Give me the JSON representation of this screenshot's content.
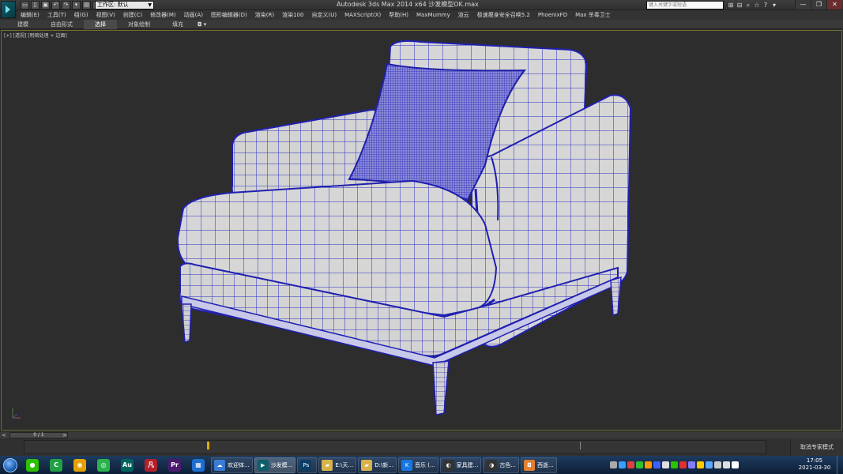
{
  "window": {
    "title": "Autodesk 3ds Max  2014 x64     沙发模型OK.max",
    "workspace_label": "工作区: 默认",
    "search_placeholder": "键入关键字或短语",
    "controls": [
      "—",
      "❐",
      "✕"
    ]
  },
  "quick_access": [
    "▭",
    "▯",
    "▣",
    "↶",
    "↷",
    "▾",
    "▤",
    "▾"
  ],
  "toolbar_right_icons": [
    "⊞",
    "⊟",
    "⌕",
    "☆",
    "?",
    "▾"
  ],
  "menu": [
    "编辑(E)",
    "工具(T)",
    "组(G)",
    "视图(V)",
    "创建(C)",
    "修改器(M)",
    "动画(A)",
    "图形编辑器(D)",
    "渲染(R)",
    "渲染100",
    "自定义(U)",
    "MAXScript(X)",
    "帮助(H)",
    "MaxMummy",
    "渲云",
    "极速瘦身安全召唤5.2",
    "PhoenixFD",
    "Max 杀毒卫士"
  ],
  "ribbon": {
    "tabs": [
      "建模",
      "自由形式",
      "选择",
      "对象绘制",
      "填充"
    ],
    "active_index": 2,
    "extra": "◘ ▾"
  },
  "viewport": {
    "label": "[+] [透视] [明暗处理 + 边面]",
    "border_color": "#6f6f2f",
    "wire_color": "#2020c0",
    "surface_color": "#d8d8d8"
  },
  "time_slider": {
    "counter": "0 / 1",
    "left_arrow": "<",
    "right_arrow": ">",
    "position": 0
  },
  "status": {
    "expert_mode": "取消专家模式"
  },
  "taskbar": {
    "pinned": [
      {
        "name": "wechat",
        "glyph": "●",
        "color": "#2dc100"
      },
      {
        "name": "camtasia",
        "glyph": "C",
        "color": "#23a045"
      },
      {
        "name": "chrome",
        "glyph": "◉",
        "color": "#e6a100"
      },
      {
        "name": "green-app",
        "glyph": "◎",
        "color": "#2bb24c"
      },
      {
        "name": "audition",
        "glyph": "Au",
        "color": "#00645e"
      },
      {
        "name": "red-app",
        "glyph": "凡",
        "color": "#b3202a"
      },
      {
        "name": "premiere",
        "glyph": "Pr",
        "color": "#4a1a6e"
      },
      {
        "name": "grid-app",
        "glyph": "▦",
        "color": "#1f6fd0"
      }
    ],
    "windows": [
      {
        "label": "欢迎体...",
        "glyph": "☁",
        "color": "#3a7bd5",
        "active": false
      },
      {
        "label": "沙发模...",
        "glyph": "▶",
        "color": "#0e5d6a",
        "active": true
      },
      {
        "label": "",
        "glyph": "Ps",
        "color": "#0a3d66",
        "active": false
      },
      {
        "label": "E:\\天...",
        "glyph": "▰",
        "color": "#d8b24a",
        "active": false
      },
      {
        "label": "D:\\新...",
        "glyph": "▰",
        "color": "#d8b24a",
        "active": false
      },
      {
        "label": "音乐 (...",
        "glyph": "K",
        "color": "#1678e0",
        "active": false
      },
      {
        "label": "家具建...",
        "glyph": "◐",
        "color": "#333",
        "active": false
      },
      {
        "label": "古色...",
        "glyph": "◑",
        "color": "#333",
        "active": false
      },
      {
        "label": "西逝...",
        "glyph": "◘",
        "color": "#e08030",
        "active": false
      }
    ],
    "tray_colors": [
      "#aaa",
      "#3aa0ff",
      "#e04040",
      "#30c030",
      "#ff9900",
      "#4060ff",
      "#e0e0e0",
      "#2dc100",
      "#e03030",
      "#8080ff",
      "#ffcc00",
      "#5fa8ff",
      "#ccc",
      "#e0e0e0",
      "#ffffff"
    ],
    "time": "17:05",
    "date": "2021-03-30"
  }
}
